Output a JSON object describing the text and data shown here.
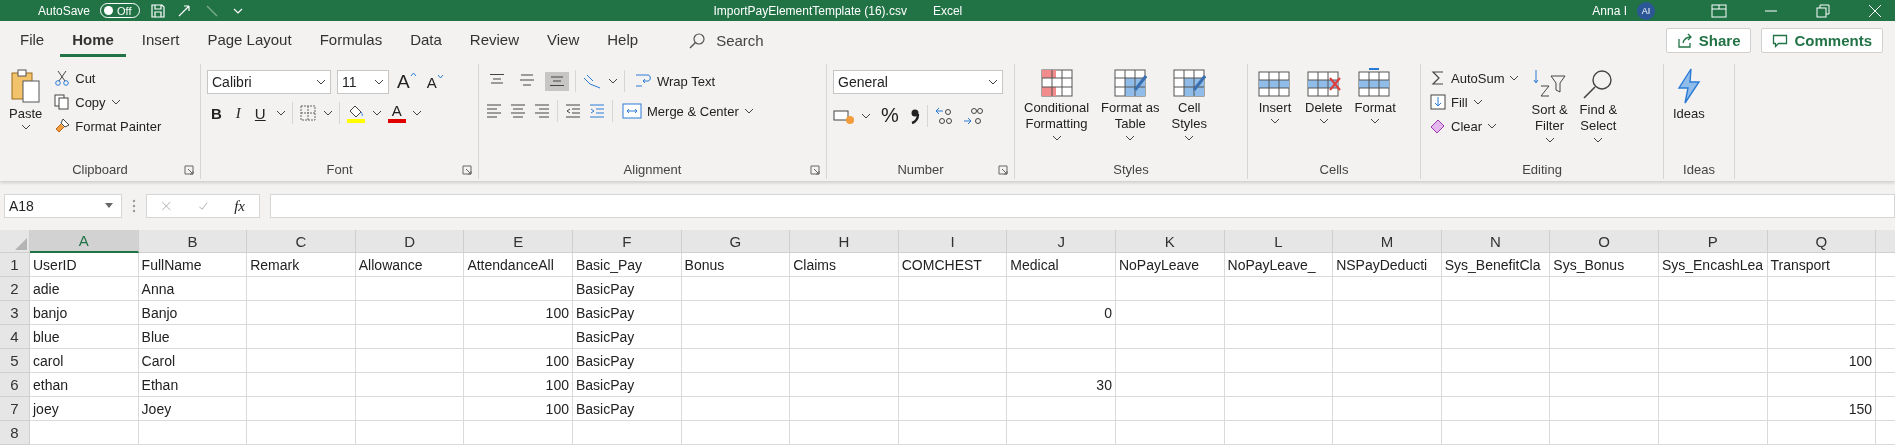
{
  "title_bar": {
    "autosave_label": "AutoSave",
    "autosave_state": "Off",
    "autosave_on": false,
    "file_name": "ImportPayElementTemplate (16).csv",
    "app_name": "Excel",
    "user_name": "Anna I",
    "avatar_initials": "AI"
  },
  "menu_tabs": [
    {
      "label": "File",
      "selected": false
    },
    {
      "label": "Home",
      "selected": true
    },
    {
      "label": "Insert",
      "selected": false
    },
    {
      "label": "Page Layout",
      "selected": false
    },
    {
      "label": "Formulas",
      "selected": false
    },
    {
      "label": "Data",
      "selected": false
    },
    {
      "label": "Review",
      "selected": false
    },
    {
      "label": "View",
      "selected": false
    },
    {
      "label": "Help",
      "selected": false
    }
  ],
  "search": {
    "placeholder": "Search"
  },
  "share_button": "Share",
  "comments_button": "Comments",
  "ribbon": {
    "clipboard": {
      "label": "Clipboard",
      "paste": "Paste",
      "cut": "Cut",
      "copy": "Copy",
      "format_painter": "Format Painter"
    },
    "font": {
      "label": "Font",
      "font_name": "Calibri",
      "font_size": "11",
      "grow": "A",
      "shrink": "A",
      "bold": "B",
      "italic": "I",
      "underline": "U",
      "font_color": "A"
    },
    "alignment": {
      "label": "Alignment",
      "vertical": [
        {
          "kind": "top",
          "selected": false
        },
        {
          "kind": "middle",
          "selected": false
        },
        {
          "kind": "bottom",
          "selected": true
        }
      ],
      "wrap_text": "Wrap Text",
      "merge_center": "Merge & Center"
    },
    "number": {
      "label": "Number",
      "format": "General",
      "percent": "%"
    },
    "styles": {
      "label": "Styles",
      "buttons": [
        {
          "lines": [
            "Conditional",
            "Formatting"
          ]
        },
        {
          "lines": [
            "Format as",
            "Table"
          ]
        },
        {
          "lines": [
            "Cell",
            "Styles"
          ]
        }
      ]
    },
    "cells": {
      "label": "Cells",
      "buttons": [
        "Insert",
        "Delete",
        "Format"
      ]
    },
    "editing": {
      "label": "Editing",
      "autosum": "AutoSum",
      "fill": "Fill",
      "clear": "Clear",
      "sort_filter": [
        "Sort &",
        "Filter"
      ],
      "find_select": [
        "Find &",
        "Select"
      ]
    },
    "ideas": {
      "label": "Ideas",
      "button": "Ideas"
    }
  },
  "name_box": "A18",
  "function_symbol": "fx",
  "sheet": {
    "columns": [
      {
        "letter": "A",
        "selected": true
      },
      {
        "letter": "B",
        "selected": false
      },
      {
        "letter": "C",
        "selected": false
      },
      {
        "letter": "D",
        "selected": false
      },
      {
        "letter": "E",
        "selected": false
      },
      {
        "letter": "F",
        "selected": false
      },
      {
        "letter": "G",
        "selected": false
      },
      {
        "letter": "H",
        "selected": false
      },
      {
        "letter": "I",
        "selected": false
      },
      {
        "letter": "J",
        "selected": false
      },
      {
        "letter": "K",
        "selected": false
      },
      {
        "letter": "L",
        "selected": false
      },
      {
        "letter": "M",
        "selected": false
      },
      {
        "letter": "N",
        "selected": false
      },
      {
        "letter": "O",
        "selected": false
      },
      {
        "letter": "P",
        "selected": false
      },
      {
        "letter": "Q",
        "selected": false
      }
    ],
    "rows": [
      {
        "number": "1",
        "cells": [
          {
            "kind": "text",
            "text": "UserID"
          },
          {
            "kind": "text",
            "text": "FullName"
          },
          {
            "kind": "text",
            "text": "Remark"
          },
          {
            "kind": "text",
            "text": "Allowance"
          },
          {
            "kind": "text",
            "text": "AttendanceAll"
          },
          {
            "kind": "text",
            "text": "Basic_Pay"
          },
          {
            "kind": "text",
            "text": "Bonus"
          },
          {
            "kind": "text",
            "text": "Claims"
          },
          {
            "kind": "text",
            "text": "COMCHEST"
          },
          {
            "kind": "text",
            "text": "Medical"
          },
          {
            "kind": "text",
            "text": "NoPayLeave"
          },
          {
            "kind": "text",
            "text": "NoPayLeave_"
          },
          {
            "kind": "text",
            "text": "NSPayDeducti"
          },
          {
            "kind": "text",
            "text": "Sys_BenefitCla"
          },
          {
            "kind": "text",
            "text": "Sys_Bonus"
          },
          {
            "kind": "text",
            "text": "Sys_EncashLea"
          },
          {
            "kind": "text",
            "text": "Transport"
          }
        ]
      },
      {
        "number": "2",
        "cells": [
          {
            "kind": "text",
            "text": "adie"
          },
          {
            "kind": "text",
            "text": "Anna"
          },
          null,
          null,
          null,
          {
            "kind": "text",
            "text": "BasicPay"
          },
          null,
          null,
          null,
          null,
          null,
          null,
          null,
          null,
          null,
          null,
          null
        ]
      },
      {
        "number": "3",
        "cells": [
          {
            "kind": "text",
            "text": "banjo"
          },
          {
            "kind": "text",
            "text": "Banjo"
          },
          null,
          null,
          {
            "kind": "number",
            "text": "100"
          },
          {
            "kind": "text",
            "text": "BasicPay"
          },
          null,
          null,
          null,
          {
            "kind": "number",
            "text": "0"
          },
          null,
          null,
          null,
          null,
          null,
          null,
          null
        ]
      },
      {
        "number": "4",
        "cells": [
          {
            "kind": "text",
            "text": "blue"
          },
          {
            "kind": "text",
            "text": "Blue"
          },
          null,
          null,
          null,
          {
            "kind": "text",
            "text": "BasicPay"
          },
          null,
          null,
          null,
          null,
          null,
          null,
          null,
          null,
          null,
          null,
          null
        ]
      },
      {
        "number": "5",
        "cells": [
          {
            "kind": "text",
            "text": "carol"
          },
          {
            "kind": "text",
            "text": "Carol"
          },
          null,
          null,
          {
            "kind": "number",
            "text": "100"
          },
          {
            "kind": "text",
            "text": "BasicPay"
          },
          null,
          null,
          null,
          null,
          null,
          null,
          null,
          null,
          null,
          null,
          {
            "kind": "number",
            "text": "100"
          }
        ]
      },
      {
        "number": "6",
        "cells": [
          {
            "kind": "text",
            "text": "ethan"
          },
          {
            "kind": "text",
            "text": "Ethan"
          },
          null,
          null,
          {
            "kind": "number",
            "text": "100"
          },
          {
            "kind": "text",
            "text": "BasicPay"
          },
          null,
          null,
          null,
          {
            "kind": "number",
            "text": "30"
          },
          null,
          null,
          null,
          null,
          null,
          null,
          null
        ]
      },
      {
        "number": "7",
        "cells": [
          {
            "kind": "text",
            "text": "joey"
          },
          {
            "kind": "text",
            "text": "Joey"
          },
          null,
          null,
          {
            "kind": "number",
            "text": "100"
          },
          {
            "kind": "text",
            "text": "BasicPay"
          },
          null,
          null,
          null,
          null,
          null,
          null,
          null,
          null,
          null,
          null,
          {
            "kind": "number",
            "text": "150"
          }
        ]
      },
      {
        "number": "8",
        "cells": [
          null,
          null,
          null,
          null,
          null,
          null,
          null,
          null,
          null,
          null,
          null,
          null,
          null,
          null,
          null,
          null,
          null
        ]
      }
    ]
  }
}
